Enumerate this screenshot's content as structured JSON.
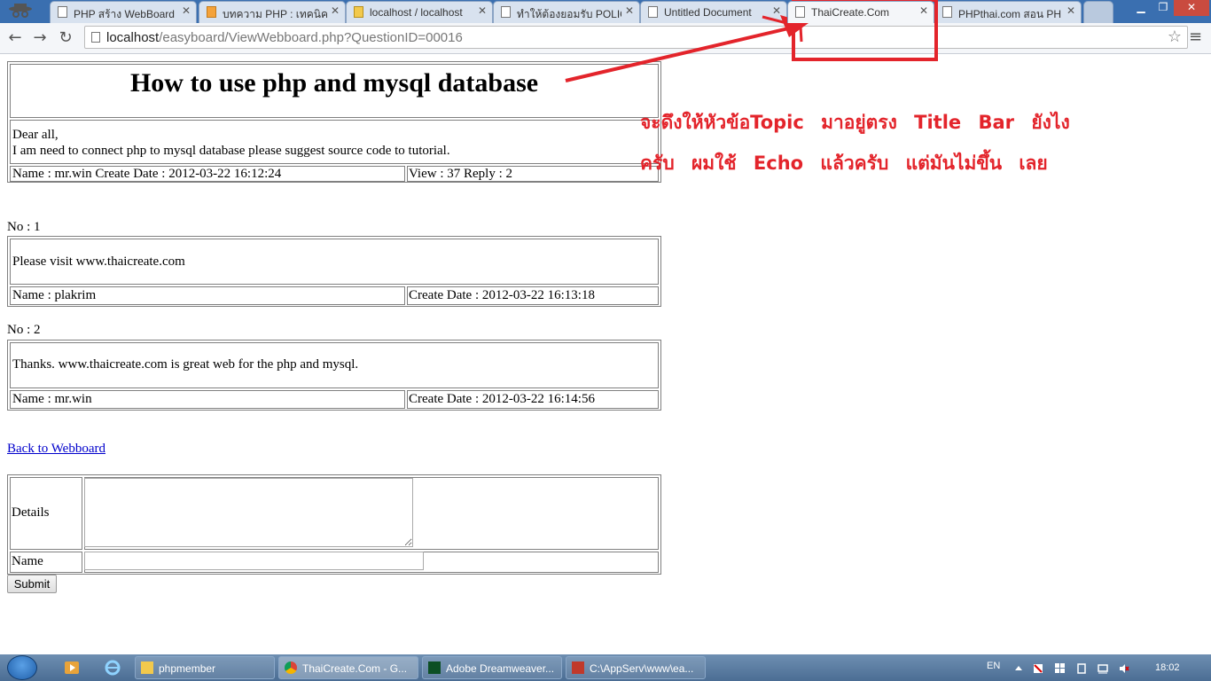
{
  "browser": {
    "tabs": [
      {
        "title": "PHP สร้าง WebBoard"
      },
      {
        "title": "บทความ PHP : เทคนิค"
      },
      {
        "title": "localhost / localhost"
      },
      {
        "title": "ทำให้ต้องยอมรับ POLIC"
      },
      {
        "title": "Untitled Document"
      },
      {
        "title": "ThaiCreate.Com"
      },
      {
        "title": "PHPthai.com สอน PH"
      }
    ],
    "active_tab": 5,
    "url_host": "localhost",
    "url_path": "/easyboard/ViewWebboard.php?QuestionID=00016",
    "window_controls": {
      "minimize": "▁",
      "maximize": "❐",
      "close": "✕"
    }
  },
  "topic": {
    "title": "How to use php and mysql database",
    "body_line1": "Dear all,",
    "body_line2": "I am need to connect php to mysql database please suggest source code to tutorial.",
    "meta_left": "Name : mr.win Create Date : 2012-03-22 16:12:24",
    "meta_right": "View : 37 Reply : 2"
  },
  "replies": [
    {
      "no_label": "No : 1",
      "text": "Please visit www.thaicreate.com",
      "name": "Name : plakrim",
      "date": "Create Date : 2012-03-22 16:13:18"
    },
    {
      "no_label": "No : 2",
      "text": "Thanks. www.thaicreate.com is great web for the php and mysql.",
      "name": "Name : mr.win",
      "date": "Create Date : 2012-03-22 16:14:56"
    }
  ],
  "back_link": "Back to Webboard",
  "form": {
    "details_label": "Details",
    "name_label": "Name",
    "submit_label": "Submit",
    "details_value": "",
    "name_value": ""
  },
  "annotation": {
    "text": "จะดึงให้หัวข้อTopic มาอยู่ตรง Title Bar ยังไง ครับ ผมใช้ Echo แล้วครับ แต่มันไม่ขึ้น เลย",
    "color": "#e3242b"
  },
  "taskbar": {
    "tasks": [
      {
        "label": "phpmember"
      },
      {
        "label": "ThaiCreate.Com - G..."
      },
      {
        "label": "Adobe Dreamweaver..."
      },
      {
        "label": "C:\\AppServ\\www\\ea..."
      }
    ],
    "language": "EN",
    "clock": "18:02"
  }
}
